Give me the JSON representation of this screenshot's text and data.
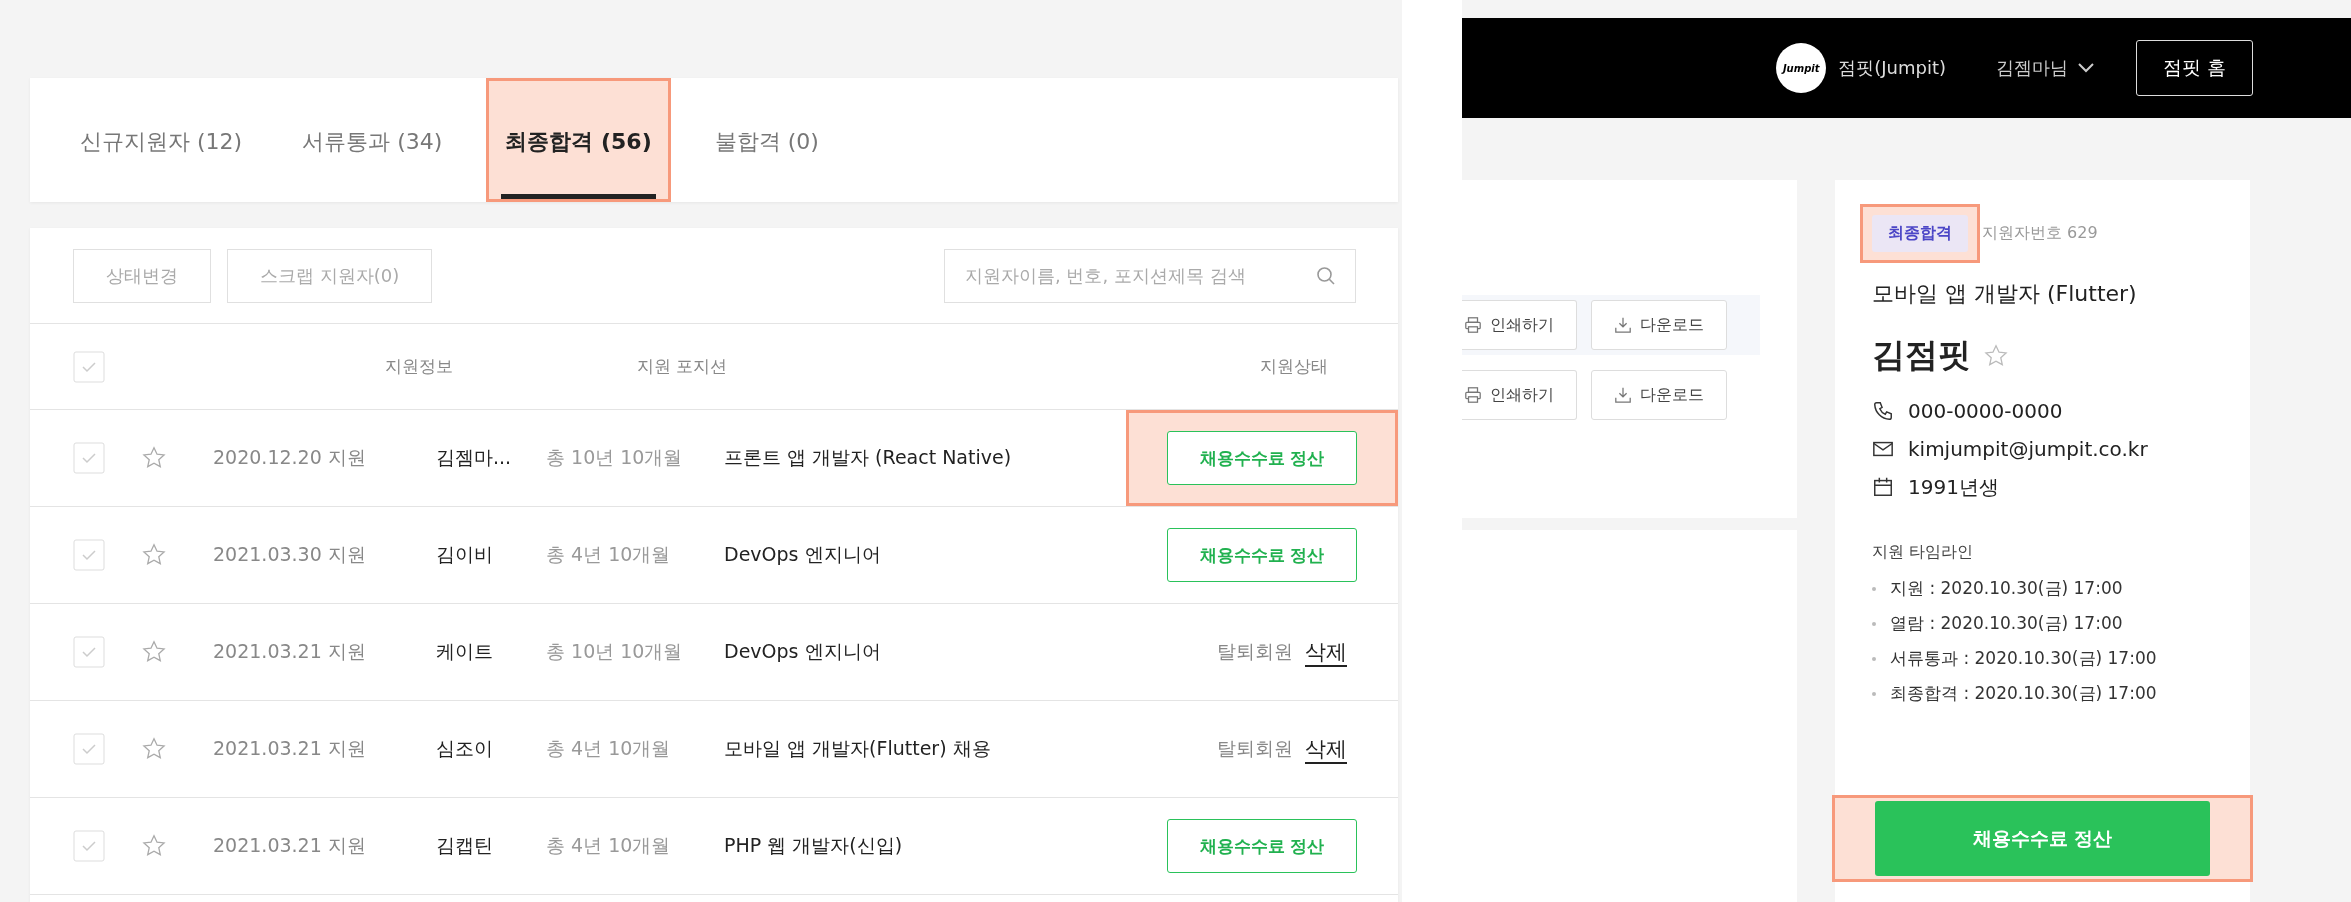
{
  "left_screen": {
    "tabs": [
      {
        "label": "신규지원자 (12)",
        "selected": false,
        "highlighted": false
      },
      {
        "label": "서류통과 (34)",
        "selected": false,
        "highlighted": false
      },
      {
        "label": "최종합격 (56)",
        "selected": true,
        "highlighted": true
      },
      {
        "label": "불합격 (0)",
        "selected": false,
        "highlighted": false
      }
    ],
    "toolbar": {
      "buttons": [
        "상태변경",
        "스크랩 지원자(0)"
      ],
      "search": {
        "placeholder": "지원자이름, 번호, 포지션제목 검색"
      }
    },
    "table": {
      "columns": [
        "지원정보",
        "지원 포지션",
        "지원상태"
      ],
      "rows": [
        {
          "date": "2020.12.20 지원",
          "name": "김젬마...",
          "career": "총 10년 10개월",
          "position": "프론트 앱 개발자 (React Native)",
          "status": {
            "kind": "button",
            "label": "채용수수료 정산",
            "highlighted": true
          }
        },
        {
          "date": "2021.03.30 지원",
          "name": "김이비",
          "career": "총 4년 10개월",
          "position": "DevOps 엔지니어",
          "status": {
            "kind": "button",
            "label": "채용수수료 정산",
            "highlighted": false
          }
        },
        {
          "date": "2021.03.21 지원",
          "name": "케이트",
          "career": "총 10년 10개월",
          "position": "DevOps 엔지니어",
          "status": {
            "kind": "withdrawn",
            "label": "탈퇴회원",
            "link": "삭제",
            "highlighted": false
          }
        },
        {
          "date": "2021.03.21 지원",
          "name": "심조이",
          "career": "총 4년 10개월",
          "position": "모바일 앱 개발자(Flutter) 채용",
          "status": {
            "kind": "withdrawn",
            "label": "탈퇴회원",
            "link": "삭제",
            "highlighted": false
          }
        },
        {
          "date": "2021.03.21 지원",
          "name": "김캡틴",
          "career": "총 4년 10개월",
          "position": "PHP 웹 개발자(신입)",
          "status": {
            "kind": "button",
            "label": "채용수수료 정산",
            "highlighted": false
          }
        }
      ]
    }
  },
  "right_screen": {
    "header": {
      "logo": "Jumpit",
      "service": "점핏(Jumpit)",
      "user": "김젬마님",
      "home_button": "점핏 홈"
    },
    "actions": [
      {
        "print": "인쇄하기",
        "download": "다운로드"
      },
      {
        "print": "인쇄하기",
        "download": "다운로드"
      }
    ],
    "profile": {
      "badge": {
        "label": "최종합격",
        "highlighted": true
      },
      "applicant_number": "지원자번호 629",
      "position": "모바일 앱 개발자 (Flutter)",
      "name": "김점핏",
      "phone": "000-0000-0000",
      "email": "kimjumpit@jumpit.co.kr",
      "birth": "1991년생",
      "timeline_title": "지원 타임라인",
      "timeline": [
        "지원 : 2020.10.30(금) 17:00",
        "열람 : 2020.10.30(금) 17:00",
        "서류통과 : 2020.10.30(금) 17:00",
        "최종합격 : 2020.10.30(금) 17:00"
      ],
      "settle_button": {
        "label": "채용수수료 정산",
        "highlighted": true
      }
    }
  }
}
